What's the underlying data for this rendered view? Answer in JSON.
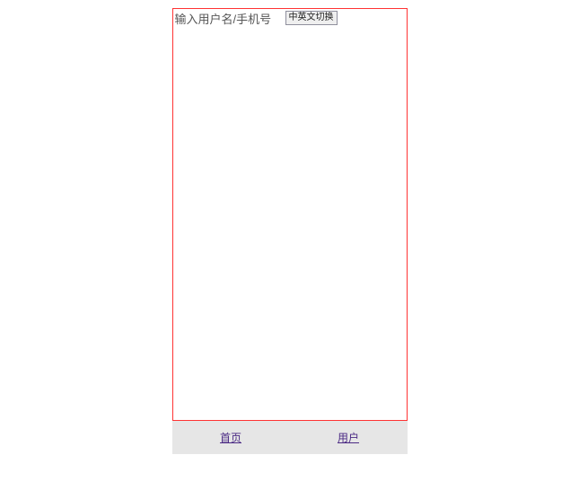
{
  "top": {
    "input_placeholder": "输入用户名/手机号",
    "toggle_label": "中英文切换"
  },
  "nav": {
    "home": "首页",
    "user": "用户"
  }
}
